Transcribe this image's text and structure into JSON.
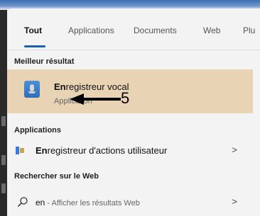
{
  "tabs": [
    {
      "label": "Tout",
      "active": true
    },
    {
      "label": "Applications"
    },
    {
      "label": "Documents"
    },
    {
      "label": "Web"
    },
    {
      "label": "Plu"
    }
  ],
  "best_result": {
    "section_title": "Meilleur résultat",
    "app_name_match": "En",
    "app_name_rest": "registreur vocal",
    "app_type": "Application",
    "icon": "voice-recorder-icon"
  },
  "annotation": {
    "number": "5"
  },
  "applications": {
    "section_title": "Applications",
    "items": [
      {
        "match": "En",
        "rest": "registreur d'actions utilisateur",
        "icon": "steps-recorder-icon"
      }
    ]
  },
  "web": {
    "section_title": "Rechercher sur le Web",
    "query": "en",
    "action": " - Afficher les résultats Web",
    "icon": "search-icon"
  },
  "colors": {
    "accent": "#1a5fb4",
    "selected_bg": "#e8d4b4",
    "panel_bg": "#f3f3f3"
  }
}
